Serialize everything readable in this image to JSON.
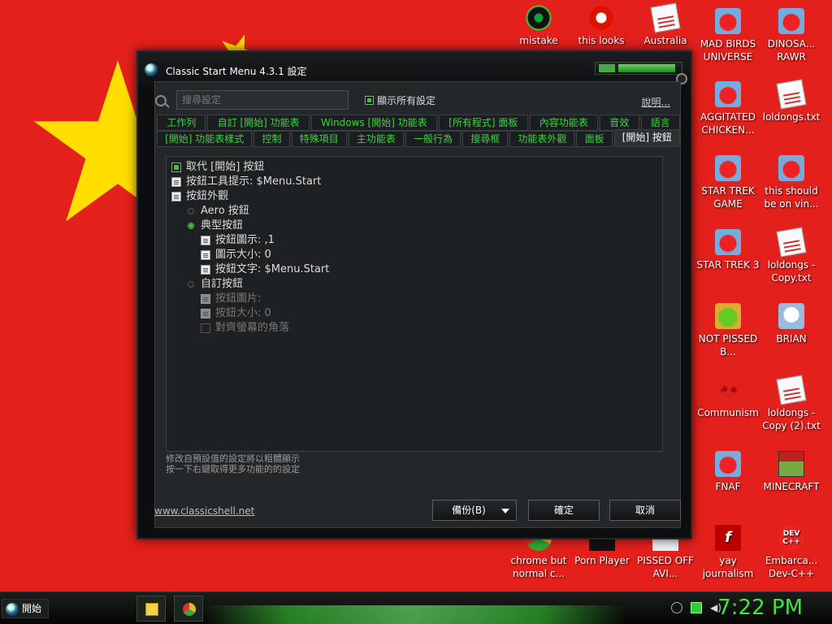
{
  "window": {
    "title": "Classic Start Menu 4.3.1 設定"
  },
  "search": {
    "placeholder": "搜尋設定"
  },
  "show_all_label": "顯示所有設定",
  "help_label": "說明...",
  "tabs_row1": [
    "工作列",
    "自訂 [開始] 功能表",
    "Windows [開始] 功能表",
    "[所有程式] 面板",
    "內容功能表",
    "音效",
    "語言"
  ],
  "tabs_row2": [
    "[開始] 功能表樣式",
    "控制",
    "特殊項目",
    "主功能表",
    "一般行為",
    "搜尋框",
    "功能表外觀",
    "面板",
    "[開始] 按鈕"
  ],
  "tree": [
    {
      "label": "取代 [開始] 按鈕",
      "glyph": "check",
      "level": 0,
      "dim": false
    },
    {
      "label": "按鈕工具提示: $Menu.Start",
      "glyph": "doc",
      "level": 0,
      "dim": false
    },
    {
      "label": "按鈕外觀",
      "glyph": "doc",
      "level": 0,
      "dim": false
    },
    {
      "label": "Aero 按鈕",
      "glyph": "radio",
      "level": 1,
      "dim": false
    },
    {
      "label": "典型按鈕",
      "glyph": "radio-on",
      "level": 1,
      "dim": false
    },
    {
      "label": "按鈕圖示: ,1",
      "glyph": "doc",
      "level": 2,
      "dim": false
    },
    {
      "label": "圖示大小: 0",
      "glyph": "doc",
      "level": 2,
      "dim": false
    },
    {
      "label": "按鈕文字: $Menu.Start",
      "glyph": "doc",
      "level": 2,
      "dim": false
    },
    {
      "label": "自訂按鈕",
      "glyph": "radio",
      "level": 1,
      "dim": false
    },
    {
      "label": "按鈕圖片:",
      "glyph": "doc",
      "level": 2,
      "dim": true
    },
    {
      "label": "按鈕大小: 0",
      "glyph": "doc",
      "level": 2,
      "dim": true
    },
    {
      "label": "對齊螢幕的角落",
      "glyph": "box",
      "level": 2,
      "dim": true
    }
  ],
  "description": {
    "line1": "修改自預設值的設定將以粗體顯示",
    "line2": "按一下右鍵取得更多功能的的設定"
  },
  "site_link": "www.classicshell.net",
  "buttons": {
    "backup": "備份(B)",
    "ok": "確定",
    "cancel": "取消"
  },
  "desktop_icons": [
    {
      "label": "mistake",
      "icon": "green-orb-icon"
    },
    {
      "label": "this looks",
      "icon": "opera-icon"
    },
    {
      "label": "Australia",
      "icon": "document-icon"
    },
    {
      "label": "MAD BIRDS UNIVERSE",
      "icon": "angry-birds-icon"
    },
    {
      "label": "DINOSA... RAWR",
      "icon": "angry-birds-icon"
    },
    {
      "label": "AGGITATED CHICKEN...",
      "icon": "angry-birds-icon"
    },
    {
      "label": "loldongs.txt",
      "icon": "text-file-icon"
    },
    {
      "label": "STAR TREK GAME",
      "icon": "angry-birds-icon"
    },
    {
      "label": "this should be on vin...",
      "icon": "angry-birds-icon"
    },
    {
      "label": "STAR TREK 3",
      "icon": "angry-birds-icon"
    },
    {
      "label": "loldongs - Copy.txt",
      "icon": "text-file-icon"
    },
    {
      "label": "NOT PISSED B...",
      "icon": "pig-icon"
    },
    {
      "label": "BRIAN",
      "icon": "brian-icon"
    },
    {
      "label": "Communism",
      "icon": "communism-icon"
    },
    {
      "label": "loldongs - Copy (2).txt",
      "icon": "text-file-icon"
    },
    {
      "label": "FNAF",
      "icon": "angry-birds-icon"
    },
    {
      "label": "MINECRAFT",
      "icon": "minecraft-icon"
    },
    {
      "label": "chrome but normal c...",
      "icon": "chrome-icon"
    },
    {
      "label": "Porn Player",
      "icon": "player-icon"
    },
    {
      "label": "PISSED OFF AVI...",
      "icon": "avi-icon"
    },
    {
      "label": "yay journalism",
      "icon": "flash-icon"
    },
    {
      "label": "Embarca... Dev-C++",
      "icon": "dev-cpp-icon"
    }
  ],
  "taskbar": {
    "start_label": "開始",
    "clock": "7:22 PM"
  },
  "colors": {
    "wallpaper_red": "#e4201c",
    "star_yellow": "#ffde00",
    "accent_green": "#3fd33f"
  }
}
